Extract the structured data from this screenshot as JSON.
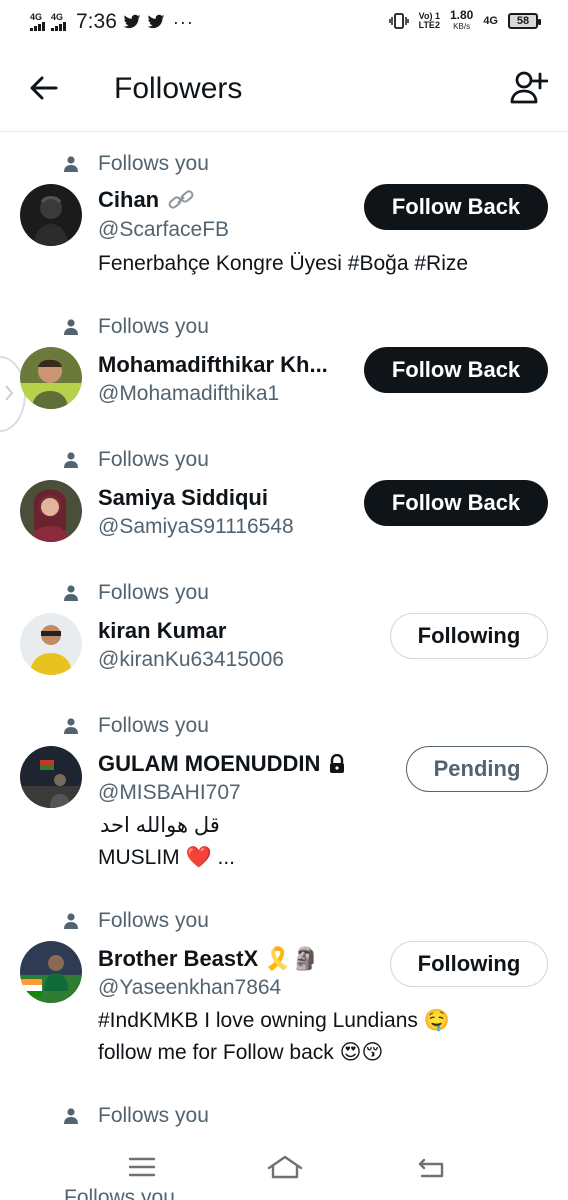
{
  "status_bar": {
    "network_left": "4G",
    "network_left2": "4G",
    "time": "7:36",
    "volte_top": "Vo) 1",
    "volte_bottom": "LTE2",
    "speed_value": "1.80",
    "speed_unit": "KB/s",
    "network_right": "4G",
    "battery": "58"
  },
  "header": {
    "title": "Followers"
  },
  "rows": [
    {
      "follows_label": "Follows you",
      "name": "Cihan",
      "badge": "link",
      "handle": "@ScarfaceFB",
      "bio": "Fenerbahçe Kongre Üyesi #Boğa #Rize",
      "button": "Follow Back"
    },
    {
      "follows_label": "Follows you",
      "name": "Mohamadifthikar Kh...",
      "handle": "@Mohamadifthika1",
      "bio": "",
      "button": "Follow Back"
    },
    {
      "follows_label": "Follows you",
      "name": "Samiya Siddiqui",
      "handle": "@SamiyaS91116548",
      "bio": "",
      "button": "Follow Back"
    },
    {
      "follows_label": "Follows you",
      "name": "kiran Kumar",
      "handle": "@kiranKu63415006",
      "bio": "",
      "button": "Following"
    },
    {
      "follows_label": "Follows you",
      "name": "GULAM MOENUDDIN",
      "badge": "lock",
      "handle": "@MISBAHI707",
      "bio_line1": "قل هوالله احد",
      "bio_line2": "MUSLIM ❤️ ...",
      "button": "Pending"
    },
    {
      "follows_label": "Follows you",
      "name": "Brother BeastX 🎗️🗿",
      "handle": "@Yaseenkhan7864",
      "bio_line1": "#IndKMKB I love owning Lundians 🤤",
      "bio_line2": "follow me for Follow back 😍😚",
      "button": "Following"
    },
    {
      "follows_label": "Follows you"
    }
  ],
  "peek_label": "Follows you",
  "icons": {
    "back": "arrow-left-icon",
    "add_user": "add-user-icon",
    "follows": "person-icon",
    "lock": "lock-icon",
    "link": "link-icon",
    "nav_menu": "menu-icon",
    "nav_home": "home-icon",
    "nav_back": "back-icon"
  },
  "colors": {
    "primary_text": "#0f1419",
    "secondary_text": "#536471",
    "dark_button": "#0f1419",
    "divider": "#e6e9ec",
    "heart": "#e0245e"
  }
}
